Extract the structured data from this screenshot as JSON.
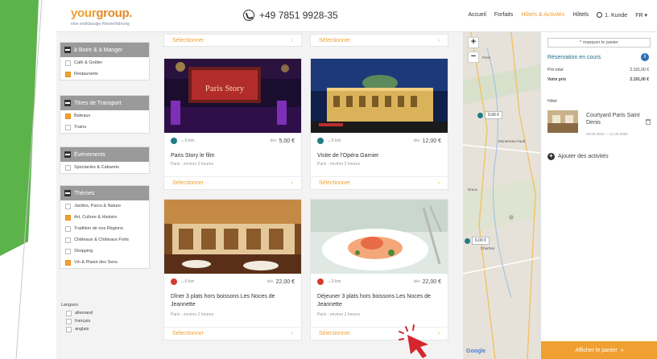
{
  "header": {
    "logo_your": "your",
    "logo_group": "group.",
    "logo_tagline": "eine erstklassige Reiseerfahrung",
    "phone": "+49 7851 9928-35",
    "nav": [
      {
        "label": "Accueil",
        "active": false
      },
      {
        "label": "Forfaits",
        "active": false
      },
      {
        "label": "Hôtels & Activités",
        "active": true
      },
      {
        "label": "Hôtels",
        "active": false
      },
      {
        "label": "1. Kunde",
        "active": false,
        "icon": "user-icon"
      },
      {
        "label": "FR ▾",
        "active": false
      }
    ]
  },
  "filters": [
    {
      "title": "à Boire & à Manger",
      "items": [
        {
          "label": "Café & Goûter",
          "checked": false
        },
        {
          "label": "Restaurants",
          "checked": true
        }
      ]
    },
    {
      "title": "Titres de Transport",
      "items": [
        {
          "label": "Bateaux",
          "checked": true
        },
        {
          "label": "Trains",
          "checked": false
        }
      ]
    },
    {
      "title": "Événements",
      "items": [
        {
          "label": "Spectacles & Cabarets",
          "checked": false
        }
      ]
    },
    {
      "title": "Thèmes",
      "items": [
        {
          "label": "Jardins, Parcs & Nature",
          "checked": false
        },
        {
          "label": "Art, Culture & Histoire",
          "checked": true
        },
        {
          "label": "Tradition de nos Régions",
          "checked": false
        },
        {
          "label": "Châteaux & Châteaux Forts",
          "checked": false
        },
        {
          "label": "Shopping",
          "checked": false
        },
        {
          "label": "Vin & Plaisir des Sens",
          "checked": true
        }
      ]
    }
  ],
  "languages": {
    "title": "Langues",
    "items": [
      "allemand",
      "français",
      "anglais"
    ]
  },
  "top_select_labels": [
    "Sélectionner",
    "Sélectionner"
  ],
  "cards": [
    {
      "title": "Paris Story le film",
      "subtitle": "Paris - environ 2 heures",
      "dist": "0 km",
      "from": "dès",
      "price": "5,00 €",
      "dot_color": "#1f7d86",
      "select": "Sélectionner"
    },
    {
      "title": "Visite de l’Opéra Garnier",
      "subtitle": "Paris - environ 2 heures",
      "dist": "0 km",
      "from": "dès",
      "price": "12,00 €",
      "dot_color": "#1f7d86",
      "select": "Sélectionner"
    },
    {
      "title": "Dîner 3 plats hors boissons Les Noces de Jeannette",
      "subtitle": "Paris - environ 2 heures",
      "dist": "0 km",
      "from": "dès",
      "price": "22,00 €",
      "dot_color": "#d63a2c",
      "select": "Sélectionner"
    },
    {
      "title": "Déjeuner 3 plats hors boissons Les Noces de Jeannette",
      "subtitle": "Paris - environ 2 heures",
      "dist": "0 km",
      "from": "dès",
      "price": "22,00 €",
      "dot_color": "#d63a2c",
      "select": "Sélectionner"
    }
  ],
  "map": {
    "pins": [
      "9,90 €",
      "6,00 €"
    ],
    "labels": [
      "Montereau-Fault",
      "Chartres",
      "Dreux",
      "Paris"
    ],
    "google": "Google"
  },
  "cart": {
    "hide_label": "^ masquer le panier",
    "reservation_title": "Réservation en cours",
    "info": "i",
    "lines": [
      {
        "label": "Prix total",
        "value": "2.191,00 €"
      },
      {
        "label": "Votre prix",
        "value": "2.191,00 €"
      }
    ],
    "hotel_label": "Hôtel",
    "hotel_name": "Courtyard Paris Saint Denis",
    "hotel_dates": "09.08.2020 — 11.08.2020",
    "add_activities": "Ajouter des activités",
    "show_cart": "Afficher le panier"
  },
  "colors": {
    "accent": "#f0a030",
    "brand_green": "#5bb34a",
    "map_pin": "#1f7d86"
  }
}
